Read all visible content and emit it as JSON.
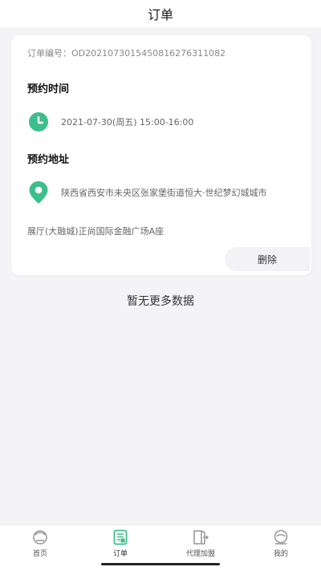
{
  "header": {
    "title": "订单"
  },
  "order": {
    "number_label": "订单编号：OD20210730154508162763110​82",
    "time_section_title": "预约时间",
    "time_value": "2021-07-30(周五) 15:00-16:00",
    "address_section_title": "预约地址",
    "address_line1": "陕西省西安市未央区张家堡街道恒大·世纪梦幻城城市",
    "address_line2": "展厅(大融城)正尚国际金融广场A座",
    "delete_label": "删除"
  },
  "list_end_text": "暂无更多数据",
  "tabbar": {
    "items": [
      {
        "label": "首页",
        "icon": "home-icon"
      },
      {
        "label": "订单",
        "icon": "order-icon"
      },
      {
        "label": "代理加盟",
        "icon": "franchise-icon"
      },
      {
        "label": "我的",
        "icon": "profile-icon"
      }
    ],
    "active_index": 1
  },
  "colors": {
    "accent": "#3dbf8c",
    "background": "#f4f4f6"
  }
}
